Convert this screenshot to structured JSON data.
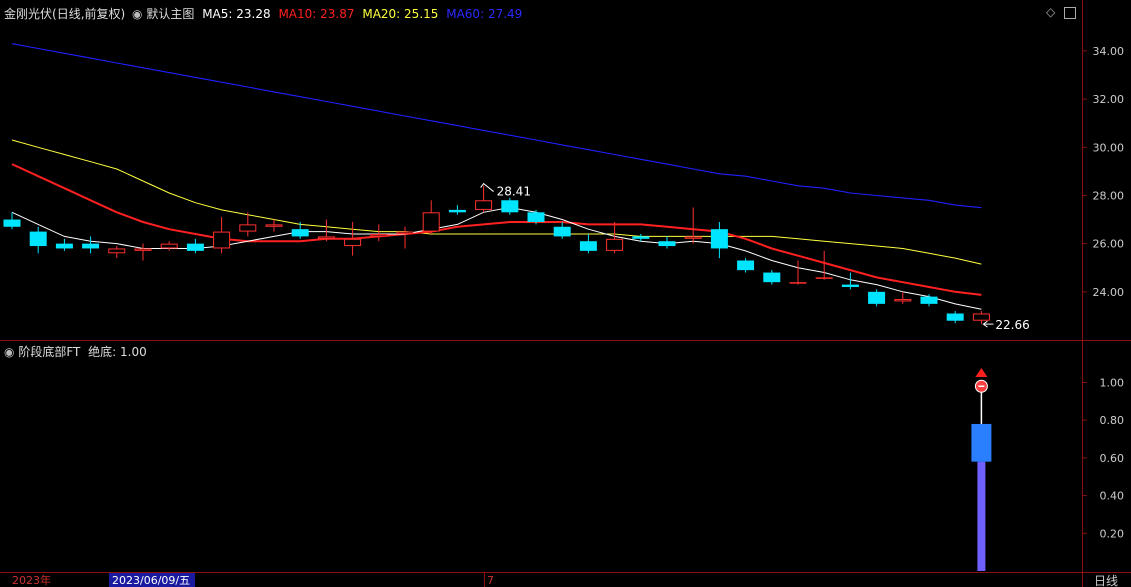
{
  "header": {
    "stock_name": "金刚光伏",
    "mode": "(日线,前复权)",
    "template": "默认主图",
    "ma_values": [
      {
        "label": "MA5:",
        "value": "23.28",
        "color": "#ffffff"
      },
      {
        "label": "MA10:",
        "value": "23.87",
        "color": "#ff2020"
      },
      {
        "label": "MA20:",
        "value": "25.15",
        "color": "#ffff40"
      },
      {
        "label": "MA60:",
        "value": "27.49",
        "color": "#2020ff"
      }
    ],
    "sub_title": "阶段底部FT",
    "sub_value_label": "绝底:",
    "sub_value": "1.00"
  },
  "price_axis": {
    "ticks": [
      "34.00",
      "32.00",
      "30.00",
      "28.00",
      "26.00",
      "24.00"
    ],
    "ylim": [
      22.0,
      35.2
    ]
  },
  "sub_axis": {
    "ticks": [
      "1.00",
      "0.80",
      "0.60",
      "0.40",
      "0.20"
    ],
    "ylim": [
      0.0,
      1.22
    ]
  },
  "time_axis": {
    "left_label": "2023年",
    "cursor_label": "2023/06/09/五",
    "month_mark": "7",
    "period": "日线"
  },
  "annotations": {
    "high_label": "28.41",
    "low_label": "22.66"
  },
  "colors": {
    "up": "#ff3030",
    "down": "#00e5ff",
    "ma5": "#ffffff",
    "ma10": "#ff2020",
    "ma20": "#ffff40",
    "ma60": "#2020ff",
    "frame": "#8b1010",
    "axis_text": "#cccccc"
  },
  "chart_data": {
    "type": "candlestick",
    "candles": [
      {
        "o": 27.0,
        "c": 26.7,
        "h": 27.3,
        "l": 26.6
      },
      {
        "o": 26.5,
        "c": 25.9,
        "h": 26.7,
        "l": 25.6
      },
      {
        "o": 26.0,
        "c": 25.8,
        "h": 26.2,
        "l": 25.7
      },
      {
        "o": 26.0,
        "c": 25.8,
        "h": 26.3,
        "l": 25.6
      },
      {
        "o": 25.6,
        "c": 25.8,
        "h": 25.9,
        "l": 25.4
      },
      {
        "o": 25.7,
        "c": 25.8,
        "h": 26.0,
        "l": 25.3
      },
      {
        "o": 25.8,
        "c": 26.0,
        "h": 26.1,
        "l": 25.7
      },
      {
        "o": 26.0,
        "c": 25.7,
        "h": 26.2,
        "l": 25.6
      },
      {
        "o": 25.8,
        "c": 26.5,
        "h": 27.1,
        "l": 25.6
      },
      {
        "o": 26.5,
        "c": 26.8,
        "h": 27.3,
        "l": 26.3
      },
      {
        "o": 26.7,
        "c": 26.8,
        "h": 27.0,
        "l": 26.5
      },
      {
        "o": 26.6,
        "c": 26.3,
        "h": 26.9,
        "l": 26.2
      },
      {
        "o": 26.2,
        "c": 26.3,
        "h": 27.0,
        "l": 26.1
      },
      {
        "o": 25.9,
        "c": 26.2,
        "h": 26.9,
        "l": 25.5
      },
      {
        "o": 26.3,
        "c": 26.4,
        "h": 26.8,
        "l": 26.1
      },
      {
        "o": 26.4,
        "c": 26.5,
        "h": 26.7,
        "l": 25.8
      },
      {
        "o": 26.5,
        "c": 27.3,
        "h": 27.8,
        "l": 26.4
      },
      {
        "o": 27.4,
        "c": 27.3,
        "h": 27.6,
        "l": 27.2
      },
      {
        "o": 27.4,
        "c": 27.8,
        "h": 28.41,
        "l": 27.3
      },
      {
        "o": 27.8,
        "c": 27.3,
        "h": 27.9,
        "l": 27.2
      },
      {
        "o": 27.3,
        "c": 26.9,
        "h": 27.4,
        "l": 26.8
      },
      {
        "o": 26.7,
        "c": 26.3,
        "h": 26.9,
        "l": 26.2
      },
      {
        "o": 26.1,
        "c": 25.7,
        "h": 26.4,
        "l": 25.6
      },
      {
        "o": 25.7,
        "c": 26.2,
        "h": 26.9,
        "l": 25.6
      },
      {
        "o": 26.3,
        "c": 26.2,
        "h": 26.4,
        "l": 26.1
      },
      {
        "o": 26.1,
        "c": 25.9,
        "h": 26.3,
        "l": 25.8
      },
      {
        "o": 26.2,
        "c": 26.3,
        "h": 27.5,
        "l": 26.0
      },
      {
        "o": 26.6,
        "c": 25.8,
        "h": 26.9,
        "l": 25.4
      },
      {
        "o": 25.3,
        "c": 24.9,
        "h": 25.4,
        "l": 24.8
      },
      {
        "o": 24.8,
        "c": 24.4,
        "h": 24.9,
        "l": 24.3
      },
      {
        "o": 24.4,
        "c": 24.4,
        "h": 25.3,
        "l": 24.3
      },
      {
        "o": 24.6,
        "c": 24.6,
        "h": 25.7,
        "l": 24.5
      },
      {
        "o": 24.3,
        "c": 24.2,
        "h": 24.8,
        "l": 24.1
      },
      {
        "o": 24.0,
        "c": 23.5,
        "h": 24.1,
        "l": 23.4
      },
      {
        "o": 23.6,
        "c": 23.7,
        "h": 24.0,
        "l": 23.5
      },
      {
        "o": 23.8,
        "c": 23.5,
        "h": 23.9,
        "l": 23.4
      },
      {
        "o": 23.1,
        "c": 22.8,
        "h": 23.2,
        "l": 22.7
      },
      {
        "o": 22.8,
        "c": 23.1,
        "h": 23.2,
        "l": 22.66
      }
    ],
    "ma5": [
      27.3,
      26.8,
      26.3,
      26.1,
      26.0,
      25.8,
      25.8,
      25.8,
      25.9,
      26.1,
      26.3,
      26.5,
      26.5,
      26.4,
      26.4,
      26.4,
      26.6,
      26.8,
      27.3,
      27.5,
      27.3,
      27.0,
      26.6,
      26.3,
      26.1,
      26.0,
      26.1,
      26.0,
      25.7,
      25.3,
      25.0,
      24.8,
      24.5,
      24.3,
      24.0,
      23.8,
      23.5,
      23.28
    ],
    "ma10": [
      29.3,
      28.8,
      28.3,
      27.8,
      27.3,
      26.9,
      26.6,
      26.4,
      26.2,
      26.1,
      26.1,
      26.1,
      26.2,
      26.2,
      26.3,
      26.4,
      26.5,
      26.7,
      26.8,
      26.9,
      26.9,
      26.9,
      26.8,
      26.8,
      26.8,
      26.7,
      26.6,
      26.5,
      26.2,
      25.8,
      25.5,
      25.2,
      24.9,
      24.6,
      24.4,
      24.2,
      24.0,
      23.87
    ],
    "ma20": [
      30.3,
      30.0,
      29.7,
      29.4,
      29.1,
      28.6,
      28.1,
      27.7,
      27.4,
      27.2,
      27.0,
      26.8,
      26.7,
      26.6,
      26.5,
      26.5,
      26.4,
      26.4,
      26.4,
      26.4,
      26.4,
      26.4,
      26.4,
      26.4,
      26.3,
      26.3,
      26.3,
      26.3,
      26.3,
      26.3,
      26.2,
      26.1,
      26.0,
      25.9,
      25.8,
      25.6,
      25.4,
      25.15
    ],
    "ma60": [
      34.3,
      34.1,
      33.9,
      33.7,
      33.5,
      33.3,
      33.1,
      32.9,
      32.7,
      32.5,
      32.3,
      32.1,
      31.9,
      31.7,
      31.5,
      31.3,
      31.1,
      30.9,
      30.7,
      30.5,
      30.3,
      30.1,
      29.9,
      29.7,
      29.5,
      29.3,
      29.1,
      28.9,
      28.8,
      28.6,
      28.4,
      28.3,
      28.1,
      28.0,
      27.9,
      27.8,
      27.6,
      27.49
    ],
    "indicator": {
      "index": 37,
      "bar_top": 0.78,
      "bar_mid": 0.58,
      "dot": 0.98,
      "arrow": 1.05
    }
  }
}
